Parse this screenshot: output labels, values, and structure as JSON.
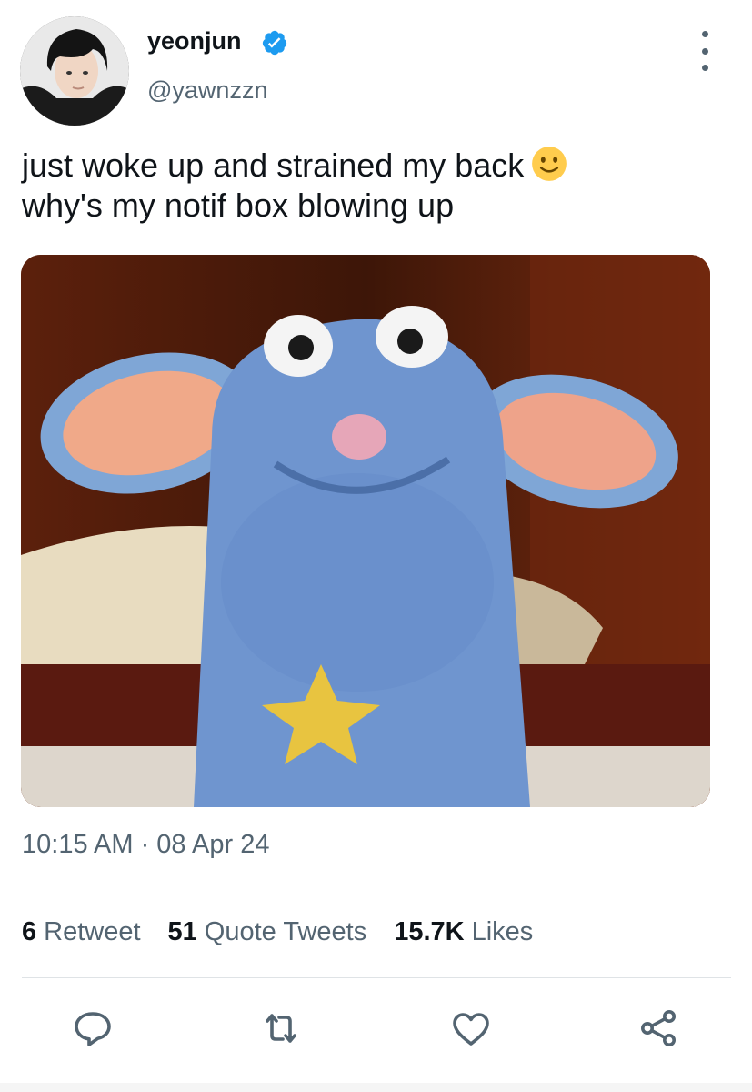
{
  "author": {
    "display_name": "yeonjun",
    "handle": "@yawnzzn",
    "verified_icon": "verified-badge-icon",
    "avatar_icon": "avatar-photo"
  },
  "menu_icon": "more-vertical-icon",
  "tweet": {
    "line1": "just woke up and strained my back",
    "line1_emoji": "slightly-smiling-face-emoji",
    "line2": "why's my notif box blowing up"
  },
  "media": {
    "kind": "photo",
    "icon": "meme-photo-blue-puppet"
  },
  "timestamp": "10:15 AM · 08 Apr 24",
  "stats": [
    {
      "count": "6",
      "label": "Retweet"
    },
    {
      "count": "51",
      "label": "Quote Tweets"
    },
    {
      "count": "15.7K",
      "label": "Likes"
    }
  ],
  "actions": [
    {
      "name": "reply",
      "icon": "reply-icon"
    },
    {
      "name": "retweet",
      "icon": "retweet-icon"
    },
    {
      "name": "like",
      "icon": "heart-icon"
    },
    {
      "name": "share",
      "icon": "share-icon"
    }
  ],
  "colors": {
    "text_primary": "#0f1419",
    "text_secondary": "#536471",
    "verified_blue": "#1d9bf0",
    "divider": "#dfe3e6"
  }
}
